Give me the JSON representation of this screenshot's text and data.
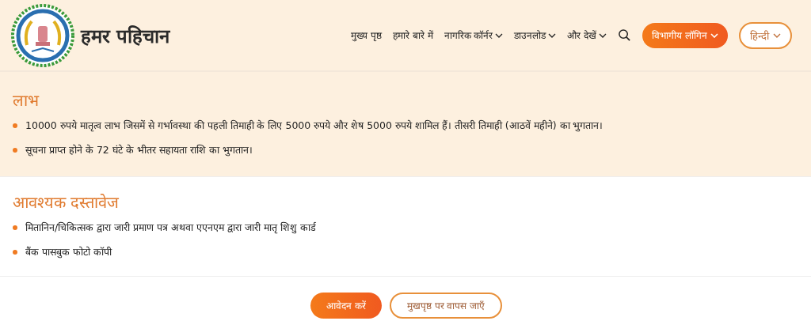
{
  "header": {
    "site_title": "हमर पहिचान",
    "nav": [
      {
        "label": "मुख्य पृष्ठ",
        "has_dropdown": false
      },
      {
        "label": "हमारे बारे में",
        "has_dropdown": false
      },
      {
        "label": "नागरिक कॉर्नर",
        "has_dropdown": true
      },
      {
        "label": "डाउनलोड",
        "has_dropdown": true
      },
      {
        "label": "और देखें",
        "has_dropdown": true
      }
    ],
    "login_button": "विभागीय लॉगिन",
    "language_button": "हिन्दी"
  },
  "sections": [
    {
      "heading": "लाभ",
      "shaded": true,
      "items": [
        "10000 रुपये मातृत्व लाभ जिसमें से गर्भावस्था की पहली तिमाही के लिए 5000 रुपये और शेष 5000 रुपये शामिल हैं। तीसरी तिमाही (आठवें महीने) का भुगतान।",
        "सूचना प्राप्त होने के 72 घंटे के भीतर सहायता राशि का भुगतान।"
      ]
    },
    {
      "heading": "आवश्यक दस्तावेज",
      "shaded": false,
      "items": [
        "मितानिन/चिकित्सक द्वारा जारी प्रमाण पत्र अथवा एएनएम द्वारा जारी मातृ शिशु कार्ड",
        "बैंक पासबुक फोटो कॉपी"
      ]
    }
  ],
  "actions": [
    {
      "label": "आवेदन करें",
      "kind": "primary"
    },
    {
      "label": "मुखपृष्ठ पर वापस जाएँ",
      "kind": "outline"
    }
  ]
}
